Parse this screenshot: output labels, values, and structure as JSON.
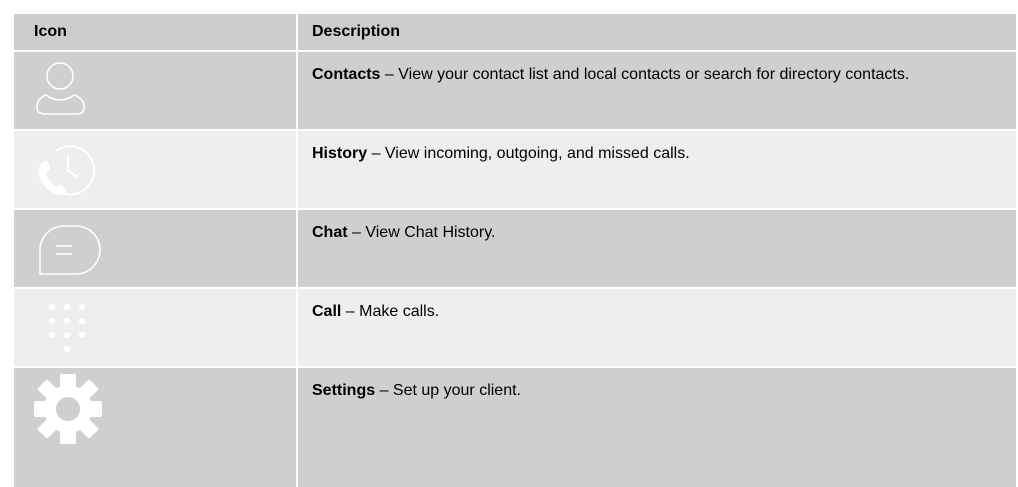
{
  "table": {
    "header": {
      "icon": "Icon",
      "description": "Description"
    },
    "rows": [
      {
        "icon": "contacts-icon",
        "title": "Contacts",
        "sep": " – ",
        "text": "View your contact list and local contacts or search for directory contacts."
      },
      {
        "icon": "history-icon",
        "title": "History",
        "sep": " – ",
        "text": "View incoming, outgoing, and missed calls."
      },
      {
        "icon": "chat-icon",
        "title": "Chat",
        "sep": " – ",
        "text": "View Chat History."
      },
      {
        "icon": "dialpad-icon",
        "title": "Call",
        "sep": " – ",
        "text": "Make calls."
      },
      {
        "icon": "gear-icon",
        "title": "Settings",
        "sep": " – ",
        "text": "Set up your client."
      }
    ]
  }
}
